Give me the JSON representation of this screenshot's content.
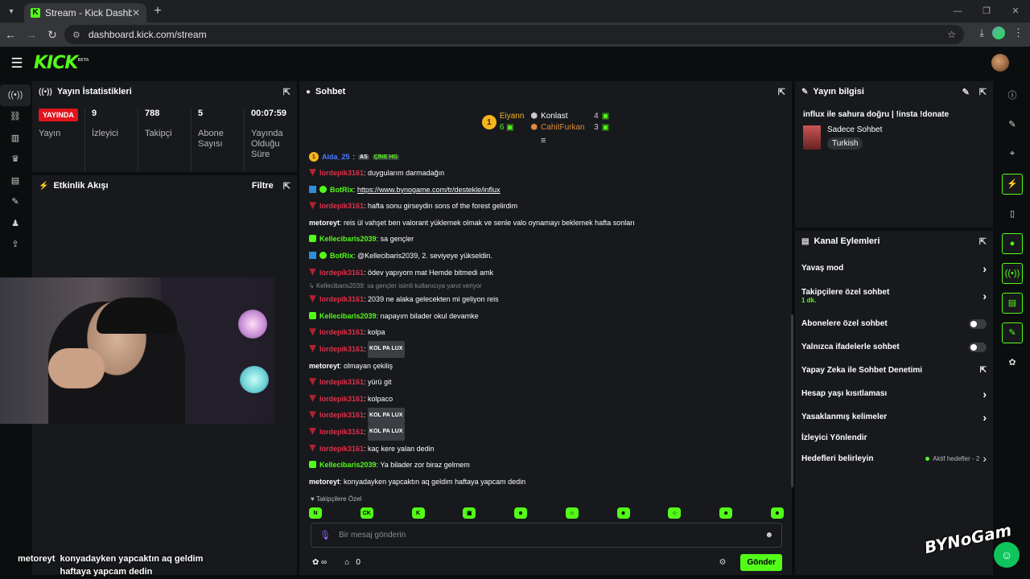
{
  "browser": {
    "tab_title": "Stream - Kick Dashboard",
    "url": "dashboard.kick.com/stream"
  },
  "header": {
    "logo": "KICK",
    "beta": "BETA"
  },
  "stats_panel": {
    "title": "Yayın İstatistikleri",
    "live_badge": "YAYINDA",
    "items": [
      {
        "value": "",
        "label": "Yayın"
      },
      {
        "value": "9",
        "label": "İzleyici"
      },
      {
        "value": "788",
        "label": "Takipçi"
      },
      {
        "value": "5",
        "label": "Abone Sayısı"
      },
      {
        "value": "00:07:59",
        "label": "Yayında Olduğu Süre"
      }
    ]
  },
  "activity_panel": {
    "title": "Etkinlik Akışı",
    "filter": "Filtre"
  },
  "chat": {
    "title": "Sohbet",
    "leaders": {
      "first_name": "Eiyann",
      "first_count": "6",
      "second_name": "Konlast",
      "second_count": "4",
      "third_name": "CahitFurkan",
      "third_count": "3",
      "rank": "1"
    },
    "first_line": {
      "rank": "1",
      "user": "Aida_25",
      "emote1": "AS",
      "emote2": "ÇİNE HG"
    },
    "messages": [
      {
        "user": "lordepik3161",
        "cls": "user-red",
        "badge": "red",
        "text": "duygularım darmadağın"
      },
      {
        "user": "BotRix",
        "cls": "user-green",
        "badge": "blue",
        "text": "https://www.bynogame.com/tr/destekle/influx",
        "link": true
      },
      {
        "user": "lordepik3161",
        "cls": "user-red",
        "badge": "red",
        "text": "hafta sonu girseydin sons of the forest gelirdim"
      },
      {
        "user": "metoreyt",
        "cls": "user-white",
        "badge": "",
        "text": "reis ül vahşet ben valorant yüklemek olmak ve senle valo oynamayı beklemek hafta sonları"
      },
      {
        "user": "Kellecibaris2039",
        "cls": "user-green",
        "badge": "green",
        "text": "sa gençler"
      },
      {
        "user": "BotRix",
        "cls": "user-green",
        "badge": "blue",
        "text": "@Kellecibaris2039, 2. seviyeye yükseldin."
      },
      {
        "user": "lordepik3161",
        "cls": "user-red",
        "badge": "red",
        "text": "ödev yapıyom mat Hemde bitmedi amk"
      },
      {
        "reply": "Kellecibaris2039: sa gençler isimli kullanıcıya yanıt veriyor"
      },
      {
        "user": "lordepik3161",
        "cls": "user-red",
        "badge": "red",
        "text": "2039 ne alaka gelecekten mi geliyon reis"
      },
      {
        "user": "Kellecibaris2039",
        "cls": "user-green",
        "badge": "green",
        "text": "napayım bilader okul devamke"
      },
      {
        "user": "lordepik3161",
        "cls": "user-red",
        "badge": "red",
        "text": "kolpa"
      },
      {
        "user": "lordepik3161",
        "cls": "user-red",
        "badge": "red",
        "text": "",
        "emote": "KOL PA LUX"
      },
      {
        "user": "metoreyt",
        "cls": "user-white",
        "badge": "",
        "text": "olmayan çekiliş"
      },
      {
        "user": "lordepik3161",
        "cls": "user-red",
        "badge": "red",
        "text": "yürü git"
      },
      {
        "user": "lordepik3161",
        "cls": "user-red",
        "badge": "red",
        "text": "kolpaco"
      },
      {
        "user": "lordepik3161",
        "cls": "user-red",
        "badge": "red",
        "text": "",
        "emote": "KOL PA LUX"
      },
      {
        "user": "lordepik3161",
        "cls": "user-red",
        "badge": "red",
        "text": "",
        "emote": "KOL PA LUX"
      },
      {
        "user": "lordepik3161",
        "cls": "user-red",
        "badge": "red",
        "text": "kaç kere yalan dedin"
      },
      {
        "user": "Kellecibaris2039",
        "cls": "user-green",
        "badge": "green",
        "text": "Ya bilader zor biraz gelmem"
      },
      {
        "user": "metoreyt",
        "cls": "user-white",
        "badge": "",
        "text": "konyadayken yapcaktın aq geldim haftaya yapcam dedin"
      }
    ],
    "pinned_label": "Takipçilere Özel",
    "placeholder": "Bir mesaj gönderin",
    "points": "0",
    "send": "Gönder"
  },
  "stream_info": {
    "title": "Yayın bilgisi",
    "stream_title": "influx ile sahura doğru | !insta !donate",
    "category": "Sadece Sohbet",
    "language": "Turkish"
  },
  "channel_actions": {
    "title": "Kanal Eylemleri",
    "items": [
      {
        "label": "Yavaş mod",
        "kind": "arrow"
      },
      {
        "label": "Takipçilere özel sohbet",
        "sub": "1 dk.",
        "kind": "arrow"
      },
      {
        "label": "Abonelere özel sohbet",
        "kind": "toggle"
      },
      {
        "label": "Yalnızca ifadelerle sohbet",
        "kind": "toggle"
      },
      {
        "label": "Yapay Zeka ile Sohbet Denetimi",
        "kind": "ext"
      },
      {
        "label": "Hesap yaşı kısıtlaması",
        "kind": "arrow"
      },
      {
        "label": "Yasaklanmış kelimeler",
        "kind": "arrow"
      },
      {
        "label": "İzleyici Yönlendir",
        "kind": "none"
      },
      {
        "label": "Hedefleri belirleyin",
        "kind": "goals",
        "goals": "Aktif hedefler - 2"
      }
    ]
  },
  "overlay_chat": {
    "user": "metoreyt",
    "text": "konyadayken yapcaktın aq geldim haftaya yapcam dedin"
  },
  "watermark": "BYNoGam",
  "colors": {
    "accent": "#53fc18",
    "live": "#e1141c",
    "panel": "#17191c"
  }
}
